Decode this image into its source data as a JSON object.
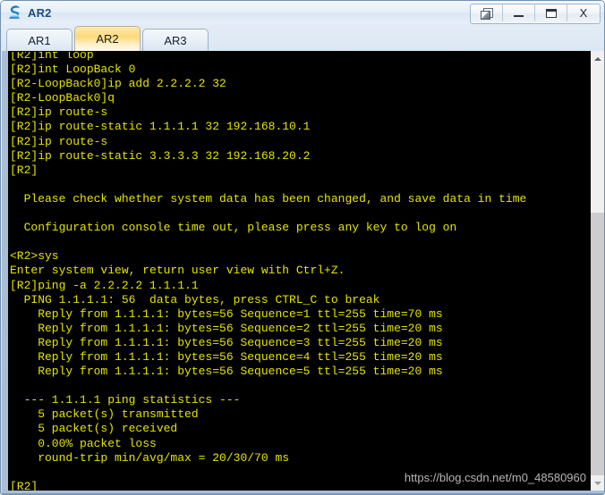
{
  "window": {
    "title": "AR2",
    "app_icon": "router-icon",
    "buttons": [
      {
        "name": "restore-windows-button",
        "icon": "cascade-windows-icon",
        "label": ""
      },
      {
        "name": "minimize-button",
        "icon": "minimize-icon",
        "label": ""
      },
      {
        "name": "maximize-button",
        "icon": "maximize-icon",
        "label": ""
      },
      {
        "name": "close-button",
        "icon": "close-icon",
        "label": "X"
      }
    ]
  },
  "tabs": [
    {
      "label": "AR1",
      "active": false
    },
    {
      "label": "AR2",
      "active": true
    },
    {
      "label": "AR3",
      "active": false
    }
  ],
  "console": {
    "prompt_color": "#e3e300",
    "background": "#000000",
    "text": "[R2]int loop\n[R2]int LoopBack 0\n[R2-LoopBack0]ip add 2.2.2.2 32\n[R2-LoopBack0]q\n[R2]ip route-s\n[R2]ip route-static 1.1.1.1 32 192.168.10.1\n[R2]ip route-s\n[R2]ip route-static 3.3.3.3 32 192.168.20.2\n[R2]\n\n  Please check whether system data has been changed, and save data in time\n\n  Configuration console time out, please press any key to log on\n\n<R2>sys\nEnter system view, return user view with Ctrl+Z.\n[R2]ping -a 2.2.2.2 1.1.1.1\n  PING 1.1.1.1: 56  data bytes, press CTRL_C to break\n    Reply from 1.1.1.1: bytes=56 Sequence=1 ttl=255 time=70 ms\n    Reply from 1.1.1.1: bytes=56 Sequence=2 ttl=255 time=20 ms\n    Reply from 1.1.1.1: bytes=56 Sequence=3 ttl=255 time=20 ms\n    Reply from 1.1.1.1: bytes=56 Sequence=4 ttl=255 time=20 ms\n    Reply from 1.1.1.1: bytes=56 Sequence=5 ttl=255 time=20 ms\n\n  --- 1.1.1.1 ping statistics ---\n    5 packet(s) transmitted\n    5 packet(s) received\n    0.00% packet loss\n    round-trip min/avg/max = 20/30/70 ms\n\n[R2]"
  },
  "watermark": {
    "text": "https://blog.csdn.net/m0_48580960"
  },
  "scrollbar": {
    "up_arrow": "chevron-up-icon",
    "down_arrow": "chevron-down-icon"
  }
}
